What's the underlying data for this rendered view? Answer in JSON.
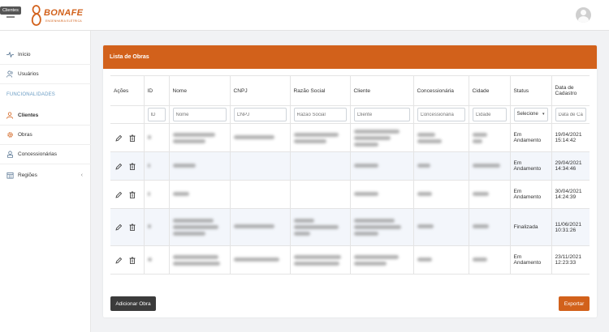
{
  "tooltip": "Clientes",
  "brand": {
    "name": "BONAFE",
    "tagline": "ENGENHARIA ELÉTRICA",
    "color": "#d2611b"
  },
  "sidebar": {
    "section_label": "FUNCIONALIDADES",
    "items": [
      {
        "label": "Início",
        "icon": "activity-icon"
      },
      {
        "label": "Usuários",
        "icon": "users-icon"
      },
      {
        "label": "Clientes",
        "icon": "user-icon",
        "active": true
      },
      {
        "label": "Obras",
        "icon": "gear-icon"
      },
      {
        "label": "Concessionárias",
        "icon": "person-badge-icon"
      },
      {
        "label": "Regiões",
        "icon": "calendar-grid-icon",
        "chevron": "‹"
      }
    ]
  },
  "card": {
    "title": "Lista de Obras",
    "columns": [
      "Ações",
      "ID",
      "Nome",
      "CNPJ",
      "Razão Social",
      "Cliente",
      "Concessionária",
      "Cidade",
      "Status",
      "Data de Cadastro"
    ],
    "filters": {
      "id": "ID",
      "nome": "Nome",
      "cnpj": "CNPJ",
      "razao_social": "Razão Social",
      "cliente": "Cliente",
      "concessionaria": "Concessionária",
      "cidade": "Cidade",
      "status_selected": "Selecione",
      "data_cadastro": "Data de Cadastro"
    },
    "rows": [
      {
        "status": "Em Andamento",
        "date": "19/04/2021",
        "time": "15:14:42"
      },
      {
        "status": "Em Andamento",
        "date": "29/04/2021",
        "time": "14:34:46"
      },
      {
        "status": "Em Andamento",
        "date": "30/04/2021",
        "time": "14:24:39"
      },
      {
        "status": "Finalizada",
        "date": "11/06/2021",
        "time": "10:31:26"
      },
      {
        "status": "Em Andamento",
        "date": "23/11/2021",
        "time": "12:23:33"
      }
    ],
    "add_button": "Adicionar Obra",
    "export_button": "Exportar"
  }
}
